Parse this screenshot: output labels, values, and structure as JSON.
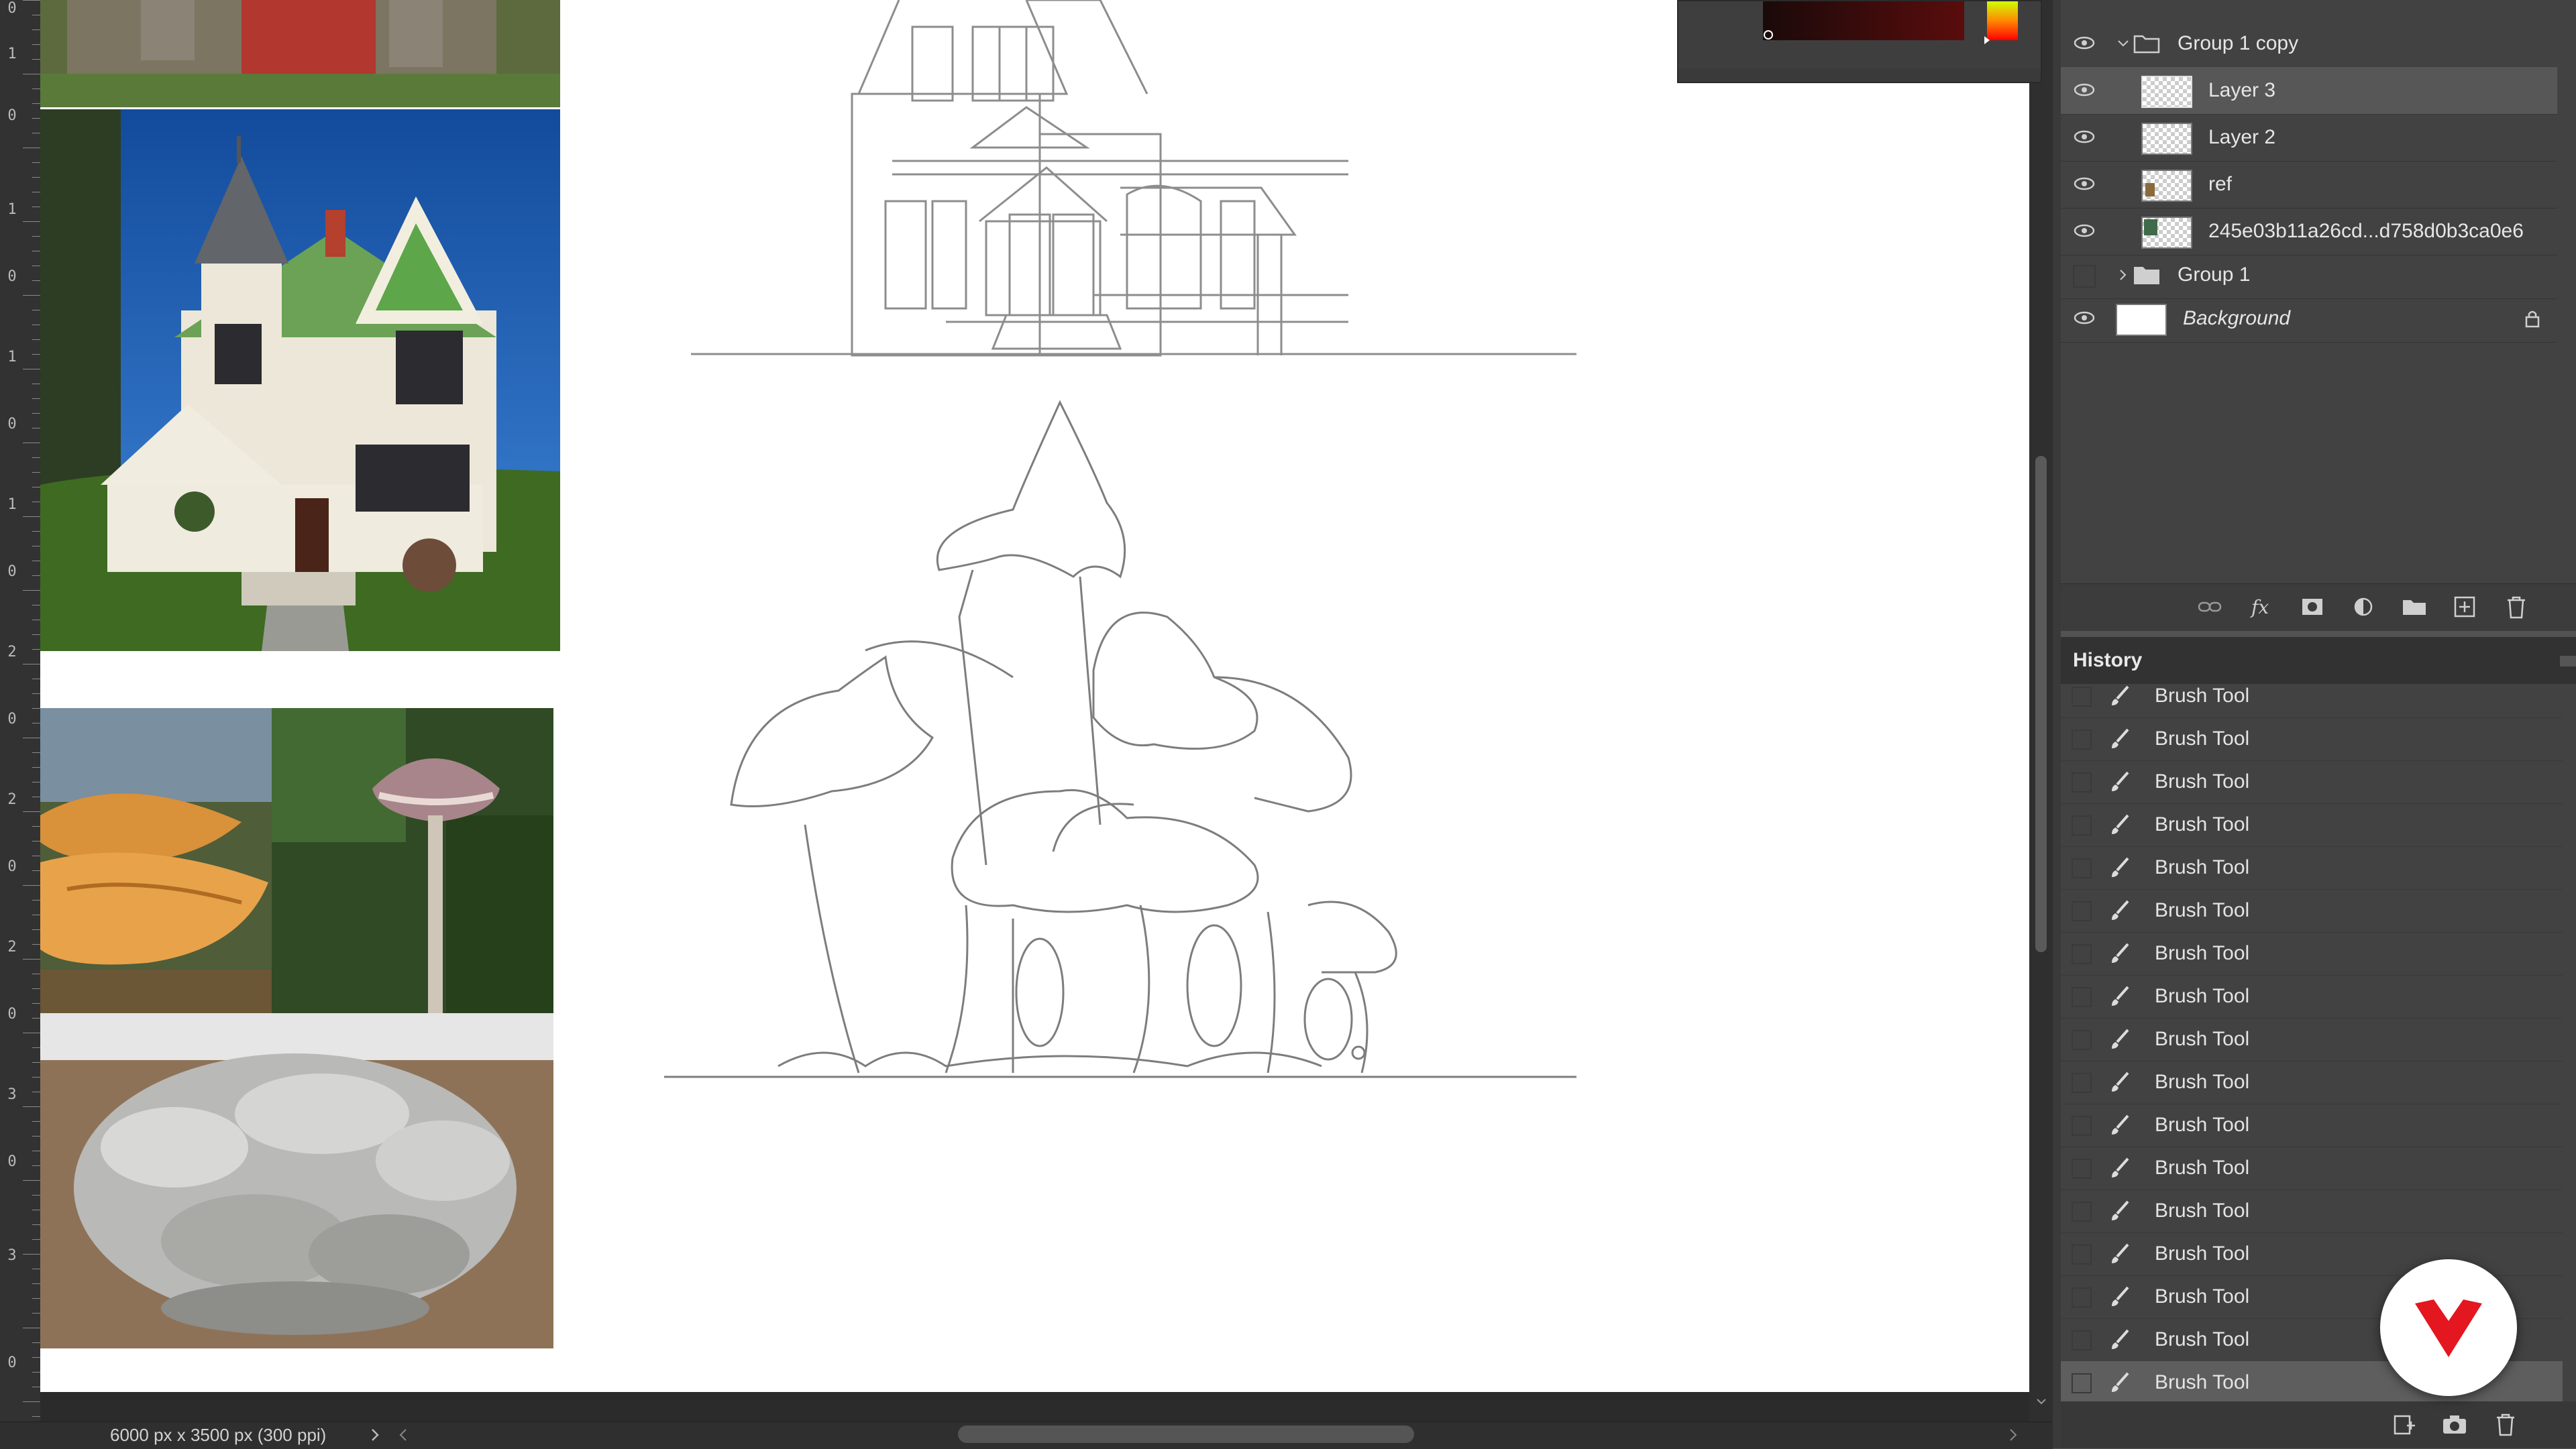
{
  "ruler": {
    "labels": [
      "0",
      "1",
      "0",
      "1",
      "0",
      "1",
      "0",
      "1",
      "0",
      "2",
      "0",
      "2",
      "0",
      "2",
      "0",
      "3",
      "0",
      "3",
      "0"
    ]
  },
  "status": {
    "doc_info": "6000 px x 3500 px (300 ppi)"
  },
  "layers": {
    "items": [
      {
        "name": "Group 1 copy",
        "type": "group",
        "expanded": true
      },
      {
        "name": "Layer 3",
        "type": "layer",
        "selected": true
      },
      {
        "name": "Layer 2",
        "type": "layer"
      },
      {
        "name": "ref",
        "type": "layer"
      },
      {
        "name": "245e03b11a26cd...d758d0b3ca0e6",
        "type": "layer"
      },
      {
        "name": "Group 1",
        "type": "group",
        "expanded": false
      },
      {
        "name": "Background",
        "type": "background",
        "locked": true
      }
    ],
    "footer_icons": [
      "link-icon",
      "fx-icon",
      "mask-icon",
      "adjustment-icon",
      "folder-icon",
      "new-layer-icon",
      "trash-icon"
    ]
  },
  "history": {
    "title": "History",
    "items": [
      "Brush Tool",
      "Brush Tool",
      "Brush Tool",
      "Brush Tool",
      "Brush Tool",
      "Brush Tool",
      "Brush Tool",
      "Brush Tool",
      "Brush Tool",
      "Brush Tool",
      "Brush Tool",
      "Brush Tool",
      "Brush Tool",
      "Brush Tool",
      "Brush Tool",
      "Brush Tool",
      "Brush Tool"
    ],
    "footer_icons": [
      "new-document-from-state-icon",
      "camera-icon",
      "trash-icon"
    ]
  },
  "colors": {
    "accent": "#e4161f",
    "panel": "#424242",
    "selected_row": "#575757"
  }
}
